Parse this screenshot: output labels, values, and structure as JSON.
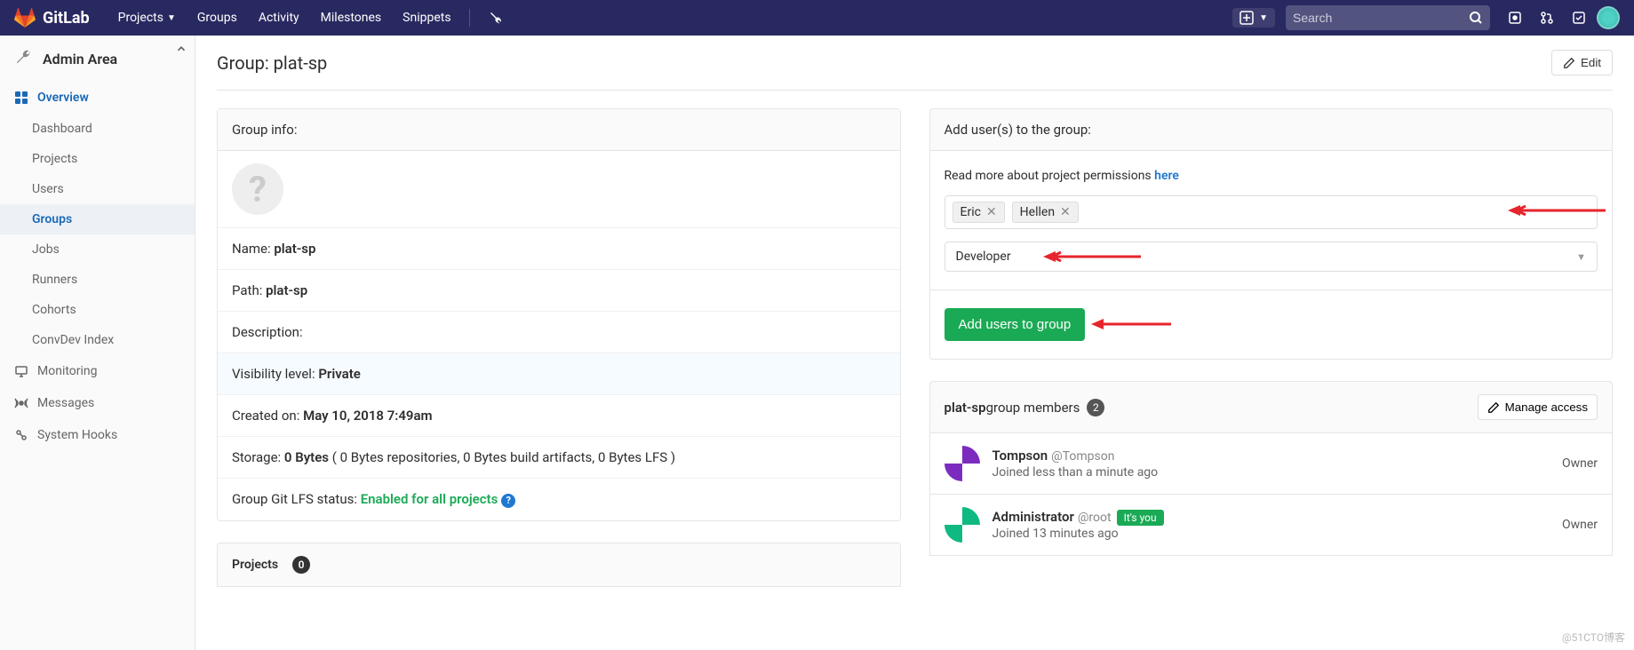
{
  "brand": "GitLab",
  "topnav": {
    "items": [
      "Projects",
      "Groups",
      "Activity",
      "Milestones",
      "Snippets"
    ],
    "search_placeholder": "Search"
  },
  "sidebar": {
    "title": "Admin Area",
    "overview_label": "Overview",
    "items": [
      "Dashboard",
      "Projects",
      "Users",
      "Groups",
      "Jobs",
      "Runners",
      "Cohorts",
      "ConvDev Index"
    ],
    "active_index": 3,
    "sections": [
      "Monitoring",
      "Messages",
      "System Hooks"
    ]
  },
  "page": {
    "title_prefix": "Group: ",
    "title_name": "plat-sp",
    "edit_label": "Edit"
  },
  "group_info": {
    "head": "Group info:",
    "name_label": "Name: ",
    "name_value": "plat-sp",
    "path_label": "Path: ",
    "path_value": "plat-sp",
    "description_label": "Description:",
    "visibility_label": "Visibility level: ",
    "visibility_value": "Private",
    "created_label": "Created on: ",
    "created_value": "May 10, 2018 7:49am",
    "storage_label": "Storage: ",
    "storage_value": "0 Bytes",
    "storage_detail": " ( 0 Bytes repositories, 0 Bytes build artifacts, 0 Bytes LFS )",
    "lfs_label": "Group Git LFS status: ",
    "lfs_value": "Enabled for all projects"
  },
  "projects_card": {
    "label": "Projects",
    "count": "0"
  },
  "add_users": {
    "head": "Add user(s) to the group:",
    "perm_text": "Read more about project permissions ",
    "perm_link": "here",
    "tokens": [
      "Eric",
      "Hellen"
    ],
    "role_selected": "Developer",
    "submit_label": "Add users to group"
  },
  "members": {
    "group_name": "plat-sp",
    "suffix": " group members",
    "count": "2",
    "manage_label": "Manage access",
    "list": [
      {
        "name": "Tompson",
        "handle": "@Tompson",
        "sub": "Joined less than a minute ago",
        "role": "Owner",
        "you": false
      },
      {
        "name": "Administrator",
        "handle": "@root",
        "sub": "Joined 13 minutes ago",
        "role": "Owner",
        "you": true
      }
    ],
    "you_label": "It's you"
  },
  "watermark": "@51CTO博客"
}
